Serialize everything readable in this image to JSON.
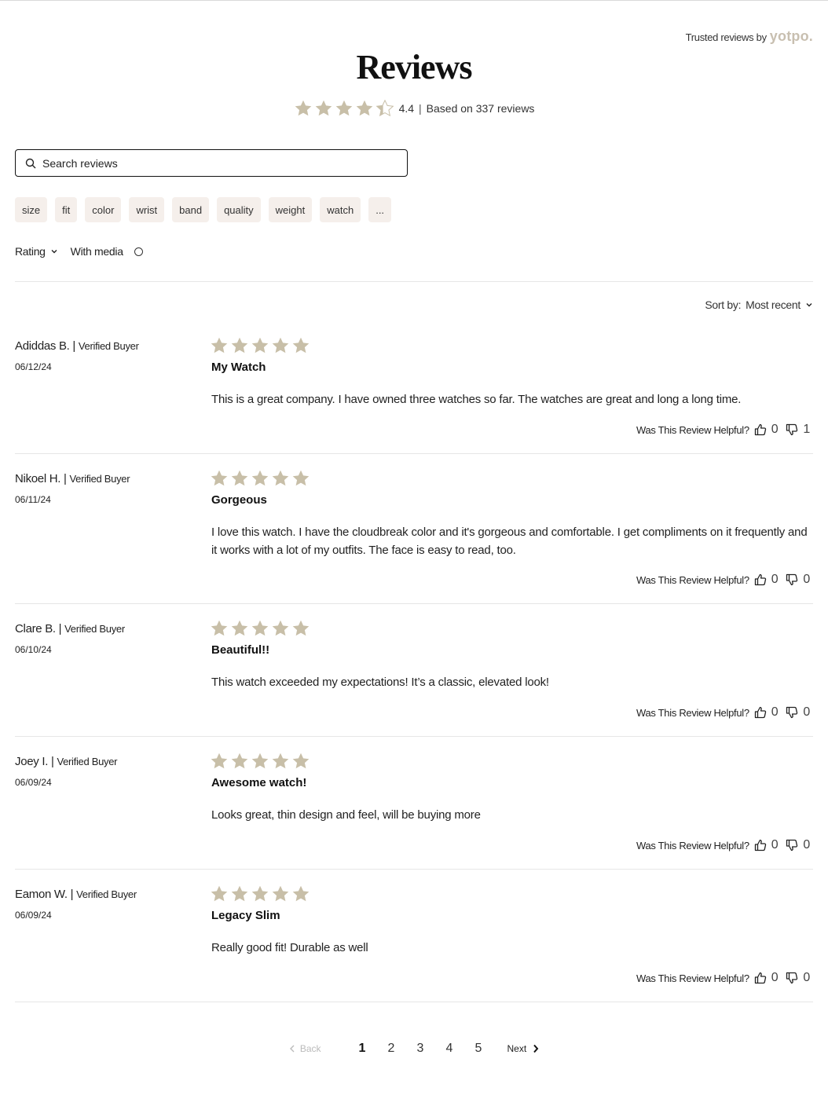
{
  "brand": {
    "trusted_label": "Trusted reviews by",
    "logo_text": "yotpo."
  },
  "header": {
    "title": "Reviews",
    "average": "4.4",
    "based_on": "Based on 337 reviews",
    "average_stars": 4.4,
    "star_color": "#c8bfa8"
  },
  "search": {
    "placeholder": "Search reviews"
  },
  "topics": [
    "size",
    "fit",
    "color",
    "wrist",
    "band",
    "quality",
    "weight",
    "watch",
    "..."
  ],
  "filters": {
    "rating_label": "Rating",
    "media_label": "With media"
  },
  "sort": {
    "label": "Sort by:",
    "value": "Most recent"
  },
  "helpful_label": "Was This Review Helpful?",
  "reviews": [
    {
      "author": "Adiddas B.",
      "badge": "Verified Buyer",
      "date": "06/12/24",
      "rating": 5,
      "title": "My Watch",
      "body": "This is a great company. I have owned three watches so far. The watches are great and long a long time.",
      "up": "0",
      "down": "1"
    },
    {
      "author": "Nikoel H.",
      "badge": "Verified Buyer",
      "date": "06/11/24",
      "rating": 5,
      "title": "Gorgeous",
      "body": "I love this watch. I have the cloudbreak color and it's gorgeous and comfortable. I get compliments on it frequently and it works with a lot of my outfits. The face is easy to read, too.",
      "up": "0",
      "down": "0"
    },
    {
      "author": "Clare B.",
      "badge": "Verified Buyer",
      "date": "06/10/24",
      "rating": 5,
      "title": "Beautiful!!",
      "body": "This watch exceeded my expectations! It’s a classic, elevated look!",
      "up": "0",
      "down": "0"
    },
    {
      "author": "Joey I.",
      "badge": "Verified Buyer",
      "date": "06/09/24",
      "rating": 5,
      "title": "Awesome watch!",
      "body": "Looks great, thin design and feel, will be buying more",
      "up": "0",
      "down": "0"
    },
    {
      "author": "Eamon W.",
      "badge": "Verified Buyer",
      "date": "06/09/24",
      "rating": 5,
      "title": "Legacy Slim",
      "body": "Really good fit! Durable as well",
      "up": "0",
      "down": "0"
    }
  ],
  "pagination": {
    "back": "Back",
    "pages": [
      "1",
      "2",
      "3",
      "4",
      "5"
    ],
    "current": "1",
    "next": "Next"
  }
}
